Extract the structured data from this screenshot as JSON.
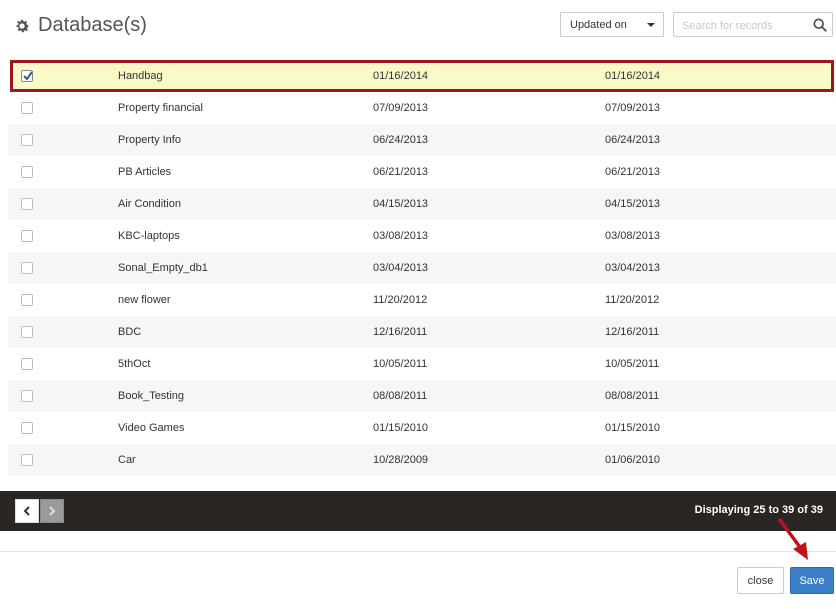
{
  "header": {
    "title": "Database(s)",
    "sort_label": "Updated on",
    "search_placeholder": "Search for records"
  },
  "rows": [
    {
      "name": "Handbag",
      "date1": "01/16/2014",
      "date2": "01/16/2014",
      "checked": true
    },
    {
      "name": "Property financial",
      "date1": "07/09/2013",
      "date2": "07/09/2013",
      "checked": false
    },
    {
      "name": "Property Info",
      "date1": "06/24/2013",
      "date2": "06/24/2013",
      "checked": false
    },
    {
      "name": "PB Articles",
      "date1": "06/21/2013",
      "date2": "06/21/2013",
      "checked": false
    },
    {
      "name": "Air Condition",
      "date1": "04/15/2013",
      "date2": "04/15/2013",
      "checked": false
    },
    {
      "name": "KBC-laptops",
      "date1": "03/08/2013",
      "date2": "03/08/2013",
      "checked": false
    },
    {
      "name": "Sonal_Empty_db1",
      "date1": "03/04/2013",
      "date2": "03/04/2013",
      "checked": false
    },
    {
      "name": "new flower",
      "date1": "11/20/2012",
      "date2": "11/20/2012",
      "checked": false
    },
    {
      "name": "BDC",
      "date1": "12/16/2011",
      "date2": "12/16/2011",
      "checked": false
    },
    {
      "name": "5thOct",
      "date1": "10/05/2011",
      "date2": "10/05/2011",
      "checked": false
    },
    {
      "name": "Book_Testing",
      "date1": "08/08/2011",
      "date2": "08/08/2011",
      "checked": false
    },
    {
      "name": "Video Games",
      "date1": "01/15/2010",
      "date2": "01/15/2010",
      "checked": false
    },
    {
      "name": "Car",
      "date1": "10/28/2009",
      "date2": "01/06/2010",
      "checked": false
    }
  ],
  "pagination": {
    "display_text": "Displaying 25 to 39 of 39"
  },
  "footer": {
    "close_label": "close",
    "save_label": "Save"
  },
  "colors": {
    "selected_row_bg": "#fafac8",
    "selected_row_border": "#a0161b",
    "footer_bar": "#2a2624",
    "save_button": "#3a7fc8",
    "annotation_arrow": "#c0141a"
  },
  "icons": {
    "title": "gear-icon",
    "search": "search-icon",
    "prev": "chevron-left-icon",
    "next": "chevron-right-icon",
    "checkbox": "checkmark-icon",
    "annotation": "red-arrow-icon"
  }
}
